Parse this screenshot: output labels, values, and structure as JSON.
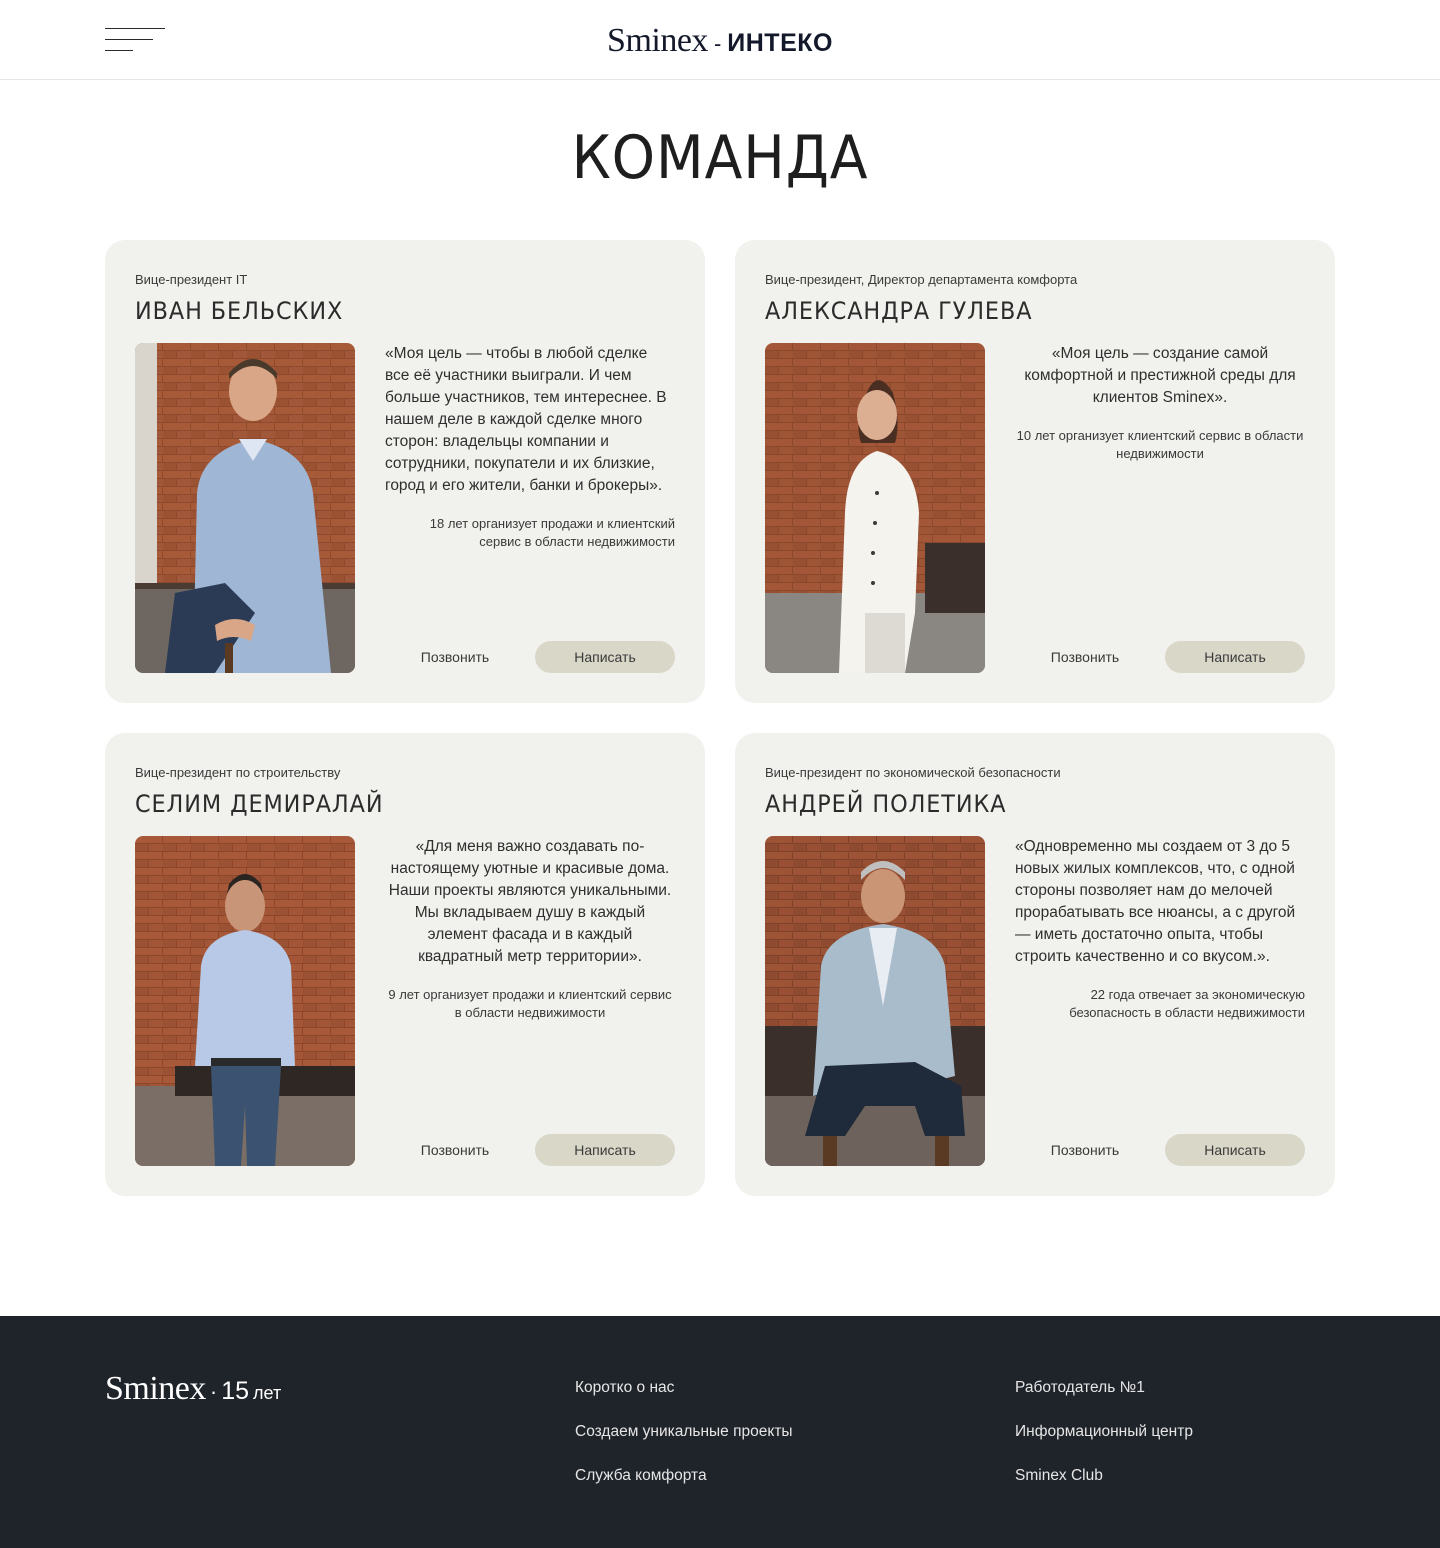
{
  "header": {
    "logo_main": "Sminex",
    "logo_dash": "-",
    "logo_partner": "ИНТЕКО"
  },
  "page_title": "КОМАНДА",
  "team": [
    {
      "role": "Вице-президент IT",
      "name": "ИВАН БЕЛЬСКИХ",
      "quote": "«Моя цель — чтобы в любой сделке все её участники выиграли. И чем больше участников, тем интереснее. В нашем деле в каждой сделке много сторон: владельцы компании и сотрудники, покупатели и их близкие, город и его жители, банки и брокеры».",
      "experience": "18 лет организует продажи и клиентский сервис в области недвижимости",
      "call_label": "Позвонить",
      "write_label": "Написать"
    },
    {
      "role": "Вице-президент, Директор департамента комфорта",
      "name": "АЛЕКСАНДРА ГУЛЕВА",
      "quote": "«Моя цель — создание самой комфортной и престижной среды для клиентов Sminex».",
      "experience": "10 лет организует клиентский сервис в области недвижимости",
      "call_label": "Позвонить",
      "write_label": "Написать"
    },
    {
      "role": "Вице-президент по строительству",
      "name": "СЕЛИМ ДЕМИРАЛАЙ",
      "quote": "«Для меня важно создавать по-настоящему уютные и красивые дома. Наши проекты являются уникальными. Мы вкладываем душу в каждый элемент фасада и в каждый квадратный метр территории».",
      "experience": "9 лет организует продажи и клиентский сервис в области недвижимости",
      "call_label": "Позвонить",
      "write_label": "Написать"
    },
    {
      "role": "Вице-президент по экономической безопасности",
      "name": "АНДРЕЙ ПОЛЕТИКА",
      "quote": "«Одновременно мы создаем от 3 до 5 новых жилых комплексов, что, с одной стороны позволяет нам до мелочей прорабатывать все нюансы, а с другой — иметь достаточно опыта, чтобы строить качественно и со вкусом.».",
      "experience": "22 года отвечает за экономическую безопасность в области недвижимости",
      "call_label": "Позвонить",
      "write_label": "Написать"
    }
  ],
  "footer": {
    "logo_main": "Sminex",
    "logo_dot": "·",
    "logo_years": "15",
    "logo_word": "лет",
    "col1": [
      "Коротко о нас",
      "Создаем уникальные проекты",
      "Служба комфорта"
    ],
    "col2": [
      "Работодатель №1",
      "Информационный центр",
      "Sminex Club"
    ]
  },
  "icons": {
    "menu": "menu-icon"
  },
  "colors": {
    "card_bg": "#f1f1ed",
    "write_button_bg": "#d9d7c8",
    "footer_bg": "#1f242b",
    "brick": "#8a4a2e"
  }
}
